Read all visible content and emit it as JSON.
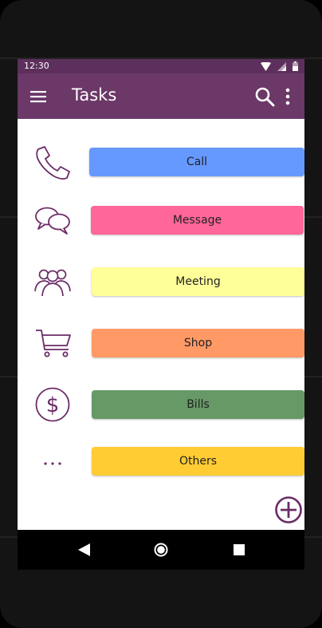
{
  "status_bar": {
    "time": "12:30"
  },
  "app_bar": {
    "title": "Tasks"
  },
  "tasks": [
    {
      "label": "Call",
      "icon": "phone-icon",
      "color": "#6699ff"
    },
    {
      "label": "Message",
      "icon": "chat-bubbles-icon",
      "color": "#ff6699"
    },
    {
      "label": "Meeting",
      "icon": "group-icon",
      "color": "#ffff99"
    },
    {
      "label": "Shop",
      "icon": "shopping-cart-icon",
      "color": "#ff9966"
    },
    {
      "label": "Bills",
      "icon": "dollar-icon",
      "color": "#669966"
    },
    {
      "label": "Others",
      "icon": "more-horizontal-icon",
      "color": "#ffcc33"
    }
  ],
  "colors": {
    "status_bar": "#5d2f5c",
    "app_bar": "#6b3868",
    "accent": "#6b2c66"
  }
}
